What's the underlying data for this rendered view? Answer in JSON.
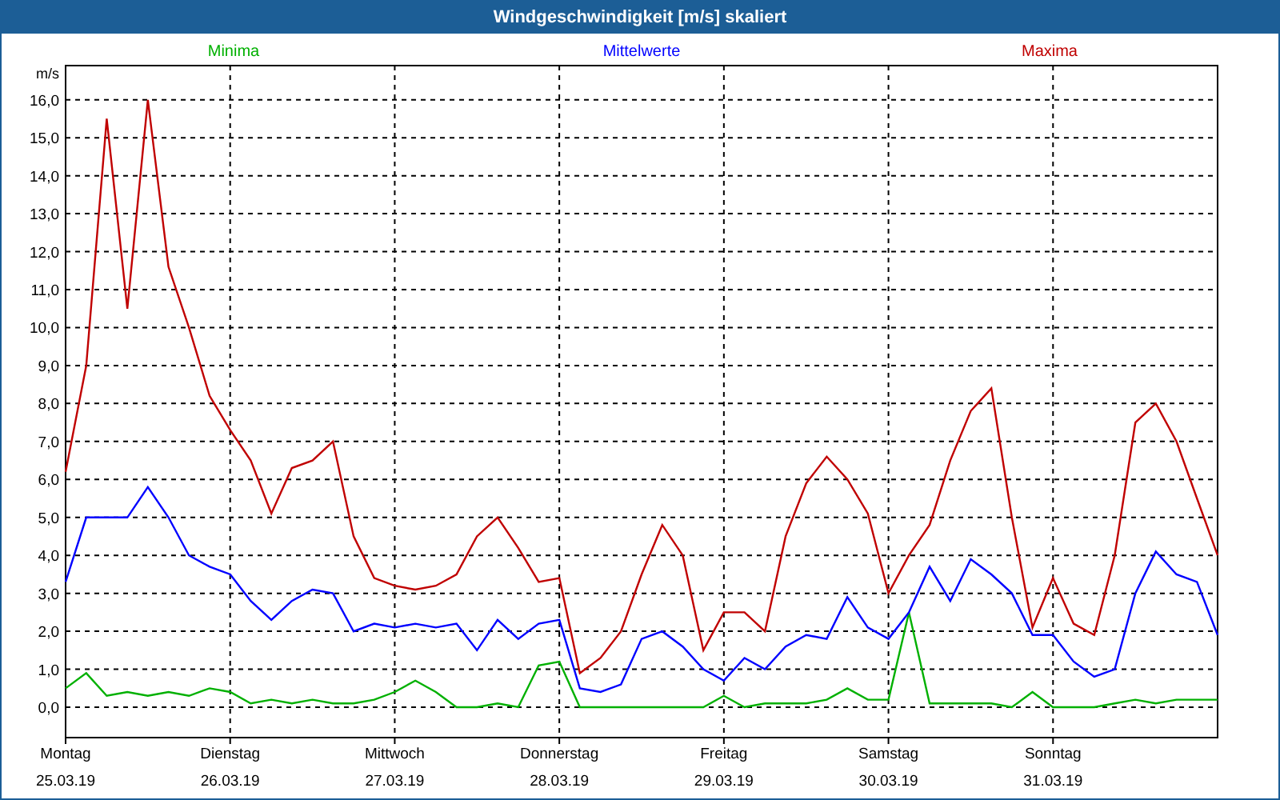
{
  "window": {
    "title": "Windgeschwindigkeit [m/s] skaliert"
  },
  "chart": {
    "chart_data": {
      "type": "line",
      "grid": true,
      "ylabel": "m/s",
      "ylim": [
        -0.8,
        16.9
      ],
      "categories": [
        "Montag\n25.03.19",
        null,
        null,
        null,
        null,
        null,
        null,
        null,
        "Dienstag\n26.03.19",
        null,
        null,
        null,
        null,
        null,
        null,
        null,
        "Mittwoch\n27.03.19",
        null,
        null,
        null,
        null,
        null,
        null,
        null,
        "Donnerstag\n28.03.19",
        null,
        null,
        null,
        null,
        null,
        null,
        null,
        "Freitag\n29.03.19",
        null,
        null,
        null,
        null,
        null,
        null,
        null,
        "Samstag\n30.03.19",
        null,
        null,
        null,
        null,
        null,
        null,
        null,
        "Sonntag\n31.03.19",
        null,
        null,
        null,
        null,
        null,
        null,
        null,
        null
      ],
      "yticks": [
        {
          "value": 0,
          "label": "0,0"
        },
        {
          "value": 1,
          "label": "1,0"
        },
        {
          "value": 2,
          "label": "2,0"
        },
        {
          "value": 3,
          "label": "3,0"
        },
        {
          "value": 4,
          "label": "4,0"
        },
        {
          "value": 5,
          "label": "5,0"
        },
        {
          "value": 6,
          "label": "6,0"
        },
        {
          "value": 7,
          "label": "7,0"
        },
        {
          "value": 8,
          "label": "8,0"
        },
        {
          "value": 9,
          "label": "9,0"
        },
        {
          "value": 10,
          "label": "10,0"
        },
        {
          "value": 11,
          "label": "11,0"
        },
        {
          "value": 12,
          "label": "12,0"
        },
        {
          "value": 13,
          "label": "13,0"
        },
        {
          "value": 14,
          "label": "14,0"
        },
        {
          "value": 15,
          "label": "15,0"
        },
        {
          "value": 16,
          "label": "16,0"
        }
      ],
      "series": [
        {
          "name": "Minima",
          "color": "#00b000",
          "values": [
            0.5,
            0.9,
            0.3,
            0.4,
            0.3,
            0.4,
            0.3,
            0.5,
            0.4,
            0.1,
            0.2,
            0.1,
            0.2,
            0.1,
            0.1,
            0.2,
            0.4,
            0.7,
            0.4,
            0.0,
            0.0,
            0.1,
            0.0,
            1.1,
            1.2,
            0.0,
            0.0,
            0.0,
            0.0,
            0.0,
            0.0,
            0.0,
            0.3,
            0.0,
            0.1,
            0.1,
            0.1,
            0.2,
            0.5,
            0.2,
            0.2,
            2.5,
            0.1,
            0.1,
            0.1,
            0.1,
            0.0,
            0.4,
            0.0,
            0.0,
            0.0,
            0.1,
            0.2,
            0.1,
            0.2,
            0.2,
            0.2
          ]
        },
        {
          "name": "Mittelwerte",
          "color": "#0000ff",
          "values": [
            3.3,
            5.0,
            5.0,
            5.0,
            5.8,
            5.0,
            4.0,
            3.7,
            3.5,
            2.8,
            2.3,
            2.8,
            3.1,
            3.0,
            2.0,
            2.2,
            2.1,
            2.2,
            2.1,
            2.2,
            1.5,
            2.3,
            1.8,
            2.2,
            2.3,
            0.5,
            0.4,
            0.6,
            1.8,
            2.0,
            1.6,
            1.0,
            0.7,
            1.3,
            1.0,
            1.6,
            1.9,
            1.8,
            2.9,
            2.1,
            1.8,
            2.5,
            3.7,
            2.8,
            3.9,
            3.5,
            3.0,
            1.9,
            1.9,
            1.2,
            0.8,
            1.0,
            3.0,
            4.1,
            3.5,
            3.3,
            1.9
          ]
        },
        {
          "name": "Maxima",
          "color": "#c00000",
          "values": [
            6.2,
            9.0,
            15.5,
            10.5,
            16.0,
            11.6,
            10.0,
            8.2,
            7.3,
            6.5,
            5.1,
            6.3,
            6.5,
            7.0,
            4.5,
            3.4,
            3.2,
            3.1,
            3.2,
            3.5,
            4.5,
            5.0,
            4.2,
            3.3,
            3.4,
            0.9,
            1.3,
            2.0,
            3.5,
            4.8,
            4.0,
            1.5,
            2.5,
            2.5,
            2.0,
            4.5,
            5.9,
            6.6,
            6.0,
            5.1,
            3.0,
            4.0,
            4.8,
            6.5,
            7.8,
            8.4,
            5.0,
            2.1,
            3.4,
            2.2,
            1.9,
            4.0,
            7.5,
            8.0,
            7.0,
            5.5,
            4.0
          ]
        }
      ]
    }
  }
}
